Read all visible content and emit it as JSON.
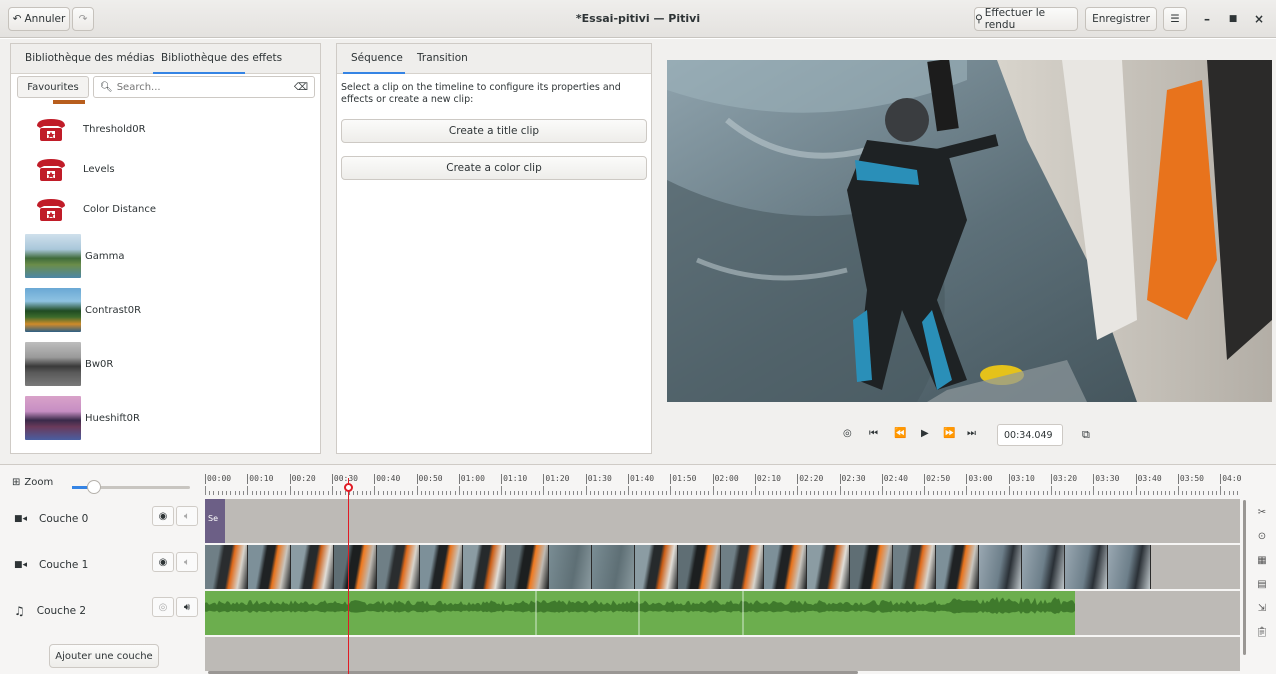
{
  "header": {
    "undo_label": "Annuler",
    "title": "*Essai-pitivi — Pitivi",
    "render_label": "Effectuer le rendu",
    "save_label": "Enregistrer",
    "menu_icon": "hamburger-icon",
    "minimize_icon": "minimize-icon",
    "maximize_icon": "maximize-icon",
    "close_icon": "close-icon"
  },
  "library": {
    "tabs": [
      "Bibliothèque des médias",
      "Bibliothèque des effets"
    ],
    "active_tab": 1,
    "category": "Favourites",
    "search_placeholder": "Search...",
    "effects": [
      "Threshold0R",
      "Levels",
      "Color Distance",
      "Gamma",
      "Contrast0R",
      "Bw0R",
      "Hueshift0R"
    ]
  },
  "clip_props": {
    "tabs": [
      "Séquence",
      "Transition"
    ],
    "active_tab": 0,
    "help_text": "Select a clip on the timeline to configure its properties and effects or create a new clip:",
    "title_clip_button": "Create a title clip",
    "color_clip_button": "Create a color clip"
  },
  "viewer": {
    "timecode": "00:34.049"
  },
  "timeline": {
    "zoom_label": "Zoom",
    "ruler": [
      "00:00",
      "00:10",
      "00:20",
      "00:30",
      "00:40",
      "00:50",
      "01:00",
      "01:10",
      "01:20",
      "01:30",
      "01:40",
      "01:50",
      "02:00",
      "02:10",
      "02:20",
      "02:30",
      "02:40",
      "02:50",
      "03:00",
      "03:10",
      "03:20",
      "03:30",
      "03:40",
      "03:50",
      "04:0"
    ],
    "layers": [
      "Couche 0",
      "Couche 1",
      "Couche 2"
    ],
    "title_clip_text": "Se",
    "add_layer_label": "Ajouter une couche"
  },
  "colors": {
    "accent": "#3584e4",
    "playhead": "#e01b24",
    "audio": "#6cae4e"
  }
}
